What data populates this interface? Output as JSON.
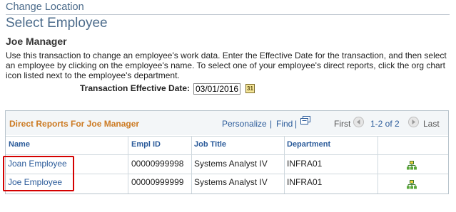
{
  "breadcrumb": "Change Location",
  "page_title": "Select Employee",
  "manager_name": "Joe Manager",
  "instructions": "Use this transaction to change an employee's work data. Enter the Effective Date for the transaction, and then select an employee by clicking on the employee's name. To select one of your employee's direct reports, click the org chart icon listed next to the employee's department.",
  "effective_date": {
    "label": "Transaction Effective Date:",
    "value": "03/01/2016",
    "icon": "calendar-icon"
  },
  "grid": {
    "title": "Direct Reports For Joe Manager",
    "personalize": "Personalize",
    "separator": "|",
    "find": "Find",
    "view_all_icon": "view-all-icon",
    "first": "First",
    "range": "1-2 of 2",
    "last": "Last",
    "columns": [
      "Name",
      "Empl ID",
      "Job Title",
      "Department"
    ],
    "rows": [
      {
        "name": "Joan Employee",
        "empl_id": "00000999998",
        "job_title": "Systems Analyst IV",
        "department": "INFRA01",
        "icon": "org-chart-icon"
      },
      {
        "name": "Joe Employee",
        "empl_id": "00000999999",
        "job_title": "Systems Analyst IV",
        "department": "INFRA01",
        "icon": "org-chart-icon"
      }
    ]
  },
  "colors": {
    "link": "#2b5b9a",
    "grid_title": "#cc7a22",
    "heading": "#4a6a8a",
    "highlight": "#d40000"
  }
}
